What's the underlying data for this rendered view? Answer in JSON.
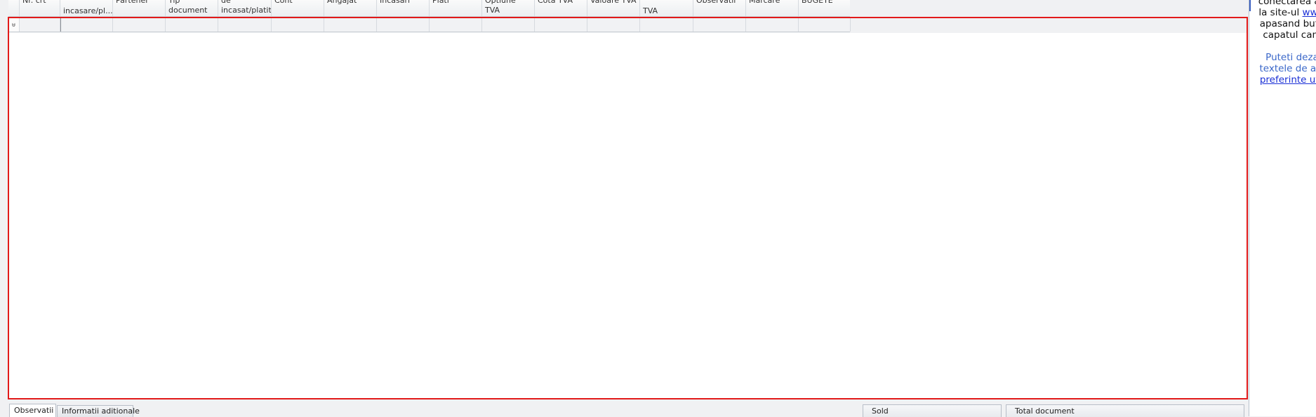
{
  "grid": {
    "columns": [
      {
        "label": ""
      },
      {
        "label": "Nr. crt"
      },
      {
        "label": "incasare/pl..."
      },
      {
        "label": "Partener"
      },
      {
        "label": "Tip document"
      },
      {
        "label": "de\nincasat/platit"
      },
      {
        "label": "Cont"
      },
      {
        "label": "Angajat"
      },
      {
        "label": "Incasari"
      },
      {
        "label": "Plati"
      },
      {
        "label": "Optiune TVA"
      },
      {
        "label": "Cota TVA"
      },
      {
        "label": "Valoare TVA"
      },
      {
        "label": "TVA"
      },
      {
        "label": "Observatii"
      },
      {
        "label": "Marcare"
      },
      {
        "label": "BUGETE"
      }
    ],
    "filter_row_indicator": "ᵾ"
  },
  "help_panel": {
    "line1": "conectarea au",
    "line2_pre": "la site-ul ",
    "line2_link": "www",
    "line3": "apasand buto",
    "line4": "capatul cam",
    "line5": "Puteti deza",
    "line6": "textele de aju",
    "line7_link": "preferinte util"
  },
  "bottom": {
    "tabs": [
      {
        "label": "Observatii",
        "active": true
      },
      {
        "label": "Informatii aditionale",
        "active": false
      }
    ],
    "sold_label": "Sold",
    "total_label": "Total document"
  }
}
